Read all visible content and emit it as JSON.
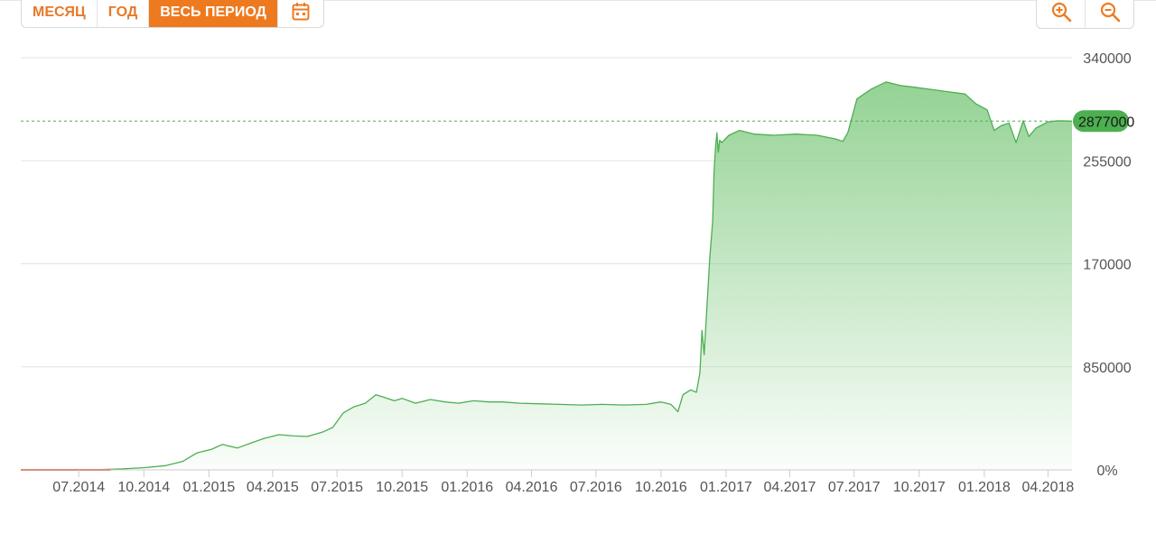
{
  "toolbar": {
    "periods": [
      "МЕСЯЦ",
      "ГОД",
      "ВЕСЬ ПЕРИОД"
    ],
    "active_period": "ВЕСЬ ПЕРИОД",
    "calendar_icon": "calendar-icon",
    "zoom_in_icon": "zoom-in-icon",
    "zoom_out_icon": "zoom-out-icon"
  },
  "colors": {
    "accent": "#ee7a20",
    "line": "#4caf50",
    "fill": "#8fd08f",
    "current_badge": "#4caf50"
  },
  "chart_data": {
    "type": "area",
    "title": "",
    "xlabel": "",
    "ylabel": "",
    "x_tick_labels": [
      "07.2014",
      "10.2014",
      "01.2015",
      "04.2015",
      "07.2015",
      "10.2015",
      "01.2016",
      "04.2016",
      "07.2016",
      "10.2016",
      "01.2017",
      "04.2017",
      "07.2017",
      "10.2017",
      "01.2018",
      "04.2018"
    ],
    "y_tick_labels": [
      "0%",
      "850000",
      "170000",
      "255000",
      "340000"
    ],
    "y_tick_values": [
      0,
      85000,
      170000,
      255000,
      340000
    ],
    "ylim": [
      0,
      340000
    ],
    "xlim": [
      "2014-04-10",
      "2018-05-05"
    ],
    "grid": true,
    "current_value": 287700,
    "current_label": "2877000",
    "series": [
      {
        "x": [
          "2014-04-10",
          "2014-08-01",
          "2014-09-01",
          "2014-10-01",
          "2014-11-01",
          "2014-11-25",
          "2014-12-15",
          "2015-01-05",
          "2015-01-20",
          "2015-02-10",
          "2015-03-01",
          "2015-03-20",
          "2015-04-10",
          "2015-05-01",
          "2015-05-20",
          "2015-06-10",
          "2015-06-25",
          "2015-07-10",
          "2015-07-25",
          "2015-08-10",
          "2015-08-25",
          "2015-09-05",
          "2015-09-20",
          "2015-10-01",
          "2015-10-20",
          "2015-11-10",
          "2015-12-01",
          "2015-12-20",
          "2016-01-10",
          "2016-02-01",
          "2016-02-20",
          "2016-03-15",
          "2016-04-10",
          "2016-05-10",
          "2016-06-10",
          "2016-07-10",
          "2016-08-10",
          "2016-09-10",
          "2016-10-01",
          "2016-10-15",
          "2016-10-25",
          "2016-11-01",
          "2016-11-12",
          "2016-11-20",
          "2016-11-25",
          "2016-11-28",
          "2016-12-01",
          "2016-12-05",
          "2016-12-09",
          "2016-12-13",
          "2016-12-15",
          "2016-12-17",
          "2016-12-19",
          "2016-12-21",
          "2016-12-23",
          "2016-12-26",
          "2017-01-05",
          "2017-01-20",
          "2017-02-10",
          "2017-03-10",
          "2017-04-10",
          "2017-05-10",
          "2017-06-05",
          "2017-06-15",
          "2017-06-22",
          "2017-07-05",
          "2017-07-25",
          "2017-08-15",
          "2017-09-05",
          "2017-09-20",
          "2017-10-15",
          "2017-11-10",
          "2017-12-05",
          "2017-12-20",
          "2018-01-05",
          "2018-01-15",
          "2018-01-25",
          "2018-02-05",
          "2018-02-15",
          "2018-02-25",
          "2018-03-05",
          "2018-03-15",
          "2018-04-01",
          "2018-04-15",
          "2018-05-05"
        ],
        "y": [
          0,
          300,
          800,
          1800,
          3500,
          7000,
          14000,
          17000,
          21000,
          18000,
          22000,
          26000,
          29000,
          28000,
          27500,
          31000,
          35000,
          47000,
          52000,
          55000,
          62000,
          60000,
          57000,
          59000,
          55000,
          58000,
          56000,
          55000,
          57000,
          56000,
          56000,
          55000,
          54500,
          54000,
          53500,
          54000,
          53500,
          54000,
          56000,
          54000,
          48000,
          62000,
          66000,
          64000,
          80000,
          115000,
          95000,
          135000,
          175000,
          205000,
          245000,
          265000,
          278000,
          262000,
          272000,
          270000,
          276000,
          280000,
          277000,
          276000,
          277000,
          276000,
          273000,
          271000,
          278000,
          306000,
          314000,
          320000,
          317000,
          316000,
          314000,
          312000,
          310000,
          302000,
          297000,
          280000,
          284000,
          286000,
          270000,
          288000,
          275000,
          282000,
          287000,
          288000,
          287700
        ]
      }
    ]
  }
}
